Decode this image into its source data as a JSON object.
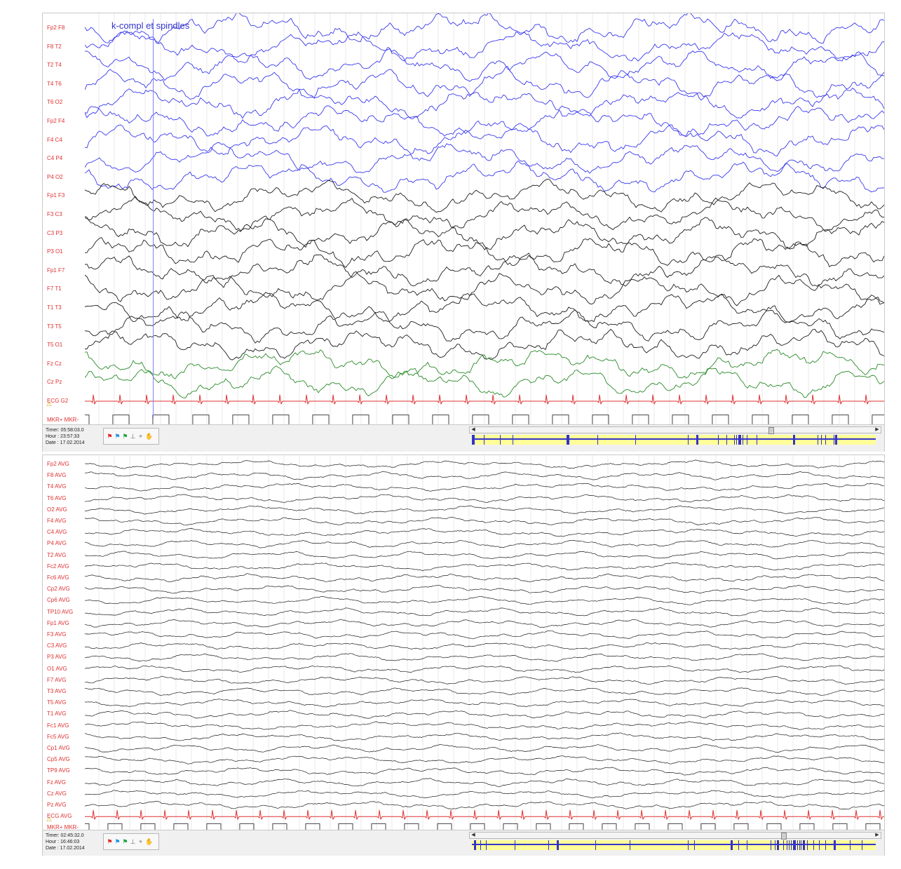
{
  "colors": {
    "blue": "#3a3aee",
    "black": "#1e1e1e",
    "green": "#2a8a2a",
    "red": "#e03030",
    "gray": "#444444",
    "label": "#e03030",
    "grid": "#dcdcdc"
  },
  "panel1": {
    "annotation": "k-compl et spindles",
    "channels": [
      {
        "label": "Fp2 F8",
        "color": "blue",
        "kind": "eeg"
      },
      {
        "label": "F8 T2",
        "color": "blue",
        "kind": "eeg"
      },
      {
        "label": "T2 T4",
        "color": "blue",
        "kind": "eeg"
      },
      {
        "label": "T4 T6",
        "color": "blue",
        "kind": "eeg"
      },
      {
        "label": "T6 O2",
        "color": "blue",
        "kind": "eeg"
      },
      {
        "label": "Fp2 F4",
        "color": "blue",
        "kind": "eeg"
      },
      {
        "label": "F4 C4",
        "color": "blue",
        "kind": "eeg"
      },
      {
        "label": "C4 P4",
        "color": "blue",
        "kind": "eeg"
      },
      {
        "label": "P4 O2",
        "color": "blue",
        "kind": "eeg"
      },
      {
        "label": "Fp1 F3",
        "color": "black",
        "kind": "eeg"
      },
      {
        "label": "F3 C3",
        "color": "black",
        "kind": "eeg"
      },
      {
        "label": "C3 P3",
        "color": "black",
        "kind": "eeg"
      },
      {
        "label": "P3 O1",
        "color": "black",
        "kind": "eeg"
      },
      {
        "label": "Fp1 F7",
        "color": "black",
        "kind": "eeg"
      },
      {
        "label": "F7 T1",
        "color": "black",
        "kind": "eeg"
      },
      {
        "label": "T1 T3",
        "color": "black",
        "kind": "eeg"
      },
      {
        "label": "T3 T5",
        "color": "black",
        "kind": "eeg"
      },
      {
        "label": "T5 O1",
        "color": "black",
        "kind": "eeg"
      },
      {
        "label": "Fz Cz",
        "color": "green",
        "kind": "eeg"
      },
      {
        "label": "Cz Pz",
        "color": "green",
        "kind": "eeg"
      },
      {
        "label": "ECG G2",
        "color": "red",
        "kind": "ecg",
        "warning": true
      },
      {
        "label": "MKR+ MKR-",
        "color": "gray",
        "kind": "marker"
      }
    ],
    "status": {
      "timer": "Timer: 05:58:03.0",
      "hour": "Hour : 23:57:33",
      "date": "Date : 17.02.2014"
    },
    "nav_markers": [
      0.0,
      0.005,
      0.03,
      0.07,
      0.1,
      0.235,
      0.24,
      0.31,
      0.405,
      0.535,
      0.555,
      0.61,
      0.63,
      0.65,
      0.655,
      0.66,
      0.665,
      0.67,
      0.68,
      0.705,
      0.795,
      0.855,
      0.865,
      0.875,
      0.895,
      0.9
    ],
    "scroll_pos": 0.74
  },
  "panel2": {
    "channels": [
      {
        "label": "Fp2 AVG",
        "color": "black",
        "kind": "eeg"
      },
      {
        "label": "F8 AVG",
        "color": "black",
        "kind": "eeg"
      },
      {
        "label": "T4 AVG",
        "color": "black",
        "kind": "eeg"
      },
      {
        "label": "T6 AVG",
        "color": "black",
        "kind": "eeg"
      },
      {
        "label": "O2 AVG",
        "color": "black",
        "kind": "eeg"
      },
      {
        "label": "F4 AVG",
        "color": "black",
        "kind": "eeg"
      },
      {
        "label": "C4 AVG",
        "color": "black",
        "kind": "eeg"
      },
      {
        "label": "P4 AVG",
        "color": "black",
        "kind": "eeg"
      },
      {
        "label": "T2 AVG",
        "color": "black",
        "kind": "eeg"
      },
      {
        "label": "Fc2 AVG",
        "color": "black",
        "kind": "eeg"
      },
      {
        "label": "Fc6 AVG",
        "color": "black",
        "kind": "eeg"
      },
      {
        "label": "Cp2 AVG",
        "color": "black",
        "kind": "eeg"
      },
      {
        "label": "Cp6 AVG",
        "color": "black",
        "kind": "eeg"
      },
      {
        "label": "TP10 AVG",
        "color": "black",
        "kind": "eeg"
      },
      {
        "label": "Fp1 AVG",
        "color": "black",
        "kind": "eeg"
      },
      {
        "label": "F3 AVG",
        "color": "black",
        "kind": "eeg"
      },
      {
        "label": "C3 AVG",
        "color": "black",
        "kind": "eeg"
      },
      {
        "label": "P3 AVG",
        "color": "black",
        "kind": "eeg"
      },
      {
        "label": "O1 AVG",
        "color": "black",
        "kind": "eeg"
      },
      {
        "label": "F7 AVG",
        "color": "black",
        "kind": "eeg"
      },
      {
        "label": "T3 AVG",
        "color": "black",
        "kind": "eeg"
      },
      {
        "label": "T5 AVG",
        "color": "black",
        "kind": "eeg"
      },
      {
        "label": "T1 AVG",
        "color": "black",
        "kind": "eeg"
      },
      {
        "label": "Fc1 AVG",
        "color": "black",
        "kind": "eeg"
      },
      {
        "label": "Fc5 AVG",
        "color": "black",
        "kind": "eeg"
      },
      {
        "label": "Cp1 AVG",
        "color": "black",
        "kind": "eeg"
      },
      {
        "label": "Cp5 AVG",
        "color": "black",
        "kind": "eeg"
      },
      {
        "label": "TP9 AVG",
        "color": "black",
        "kind": "eeg"
      },
      {
        "label": "Fz AVG",
        "color": "black",
        "kind": "eeg"
      },
      {
        "label": "Cz AVG",
        "color": "black",
        "kind": "eeg"
      },
      {
        "label": "Pz AVG",
        "color": "black",
        "kind": "eeg"
      },
      {
        "label": "ECG AVG",
        "color": "red",
        "kind": "ecg",
        "warning": true
      },
      {
        "label": "MKR+ MKR-",
        "color": "gray",
        "kind": "marker"
      }
    ],
    "status": {
      "timer": "Timer: 02:45:32.0",
      "hour": "Hour : 16:46:03",
      "date": "Date : 17.02.2014"
    },
    "nav_markers": [
      0.005,
      0.02,
      0.035,
      0.105,
      0.19,
      0.21,
      0.305,
      0.39,
      0.535,
      0.55,
      0.64,
      0.66,
      0.68,
      0.74,
      0.75,
      0.755,
      0.77,
      0.78,
      0.785,
      0.79,
      0.795,
      0.8,
      0.805,
      0.81,
      0.815,
      0.82,
      0.83,
      0.845,
      0.86,
      0.875,
      0.895,
      0.935,
      0.965
    ],
    "scroll_pos": 0.77
  },
  "toolbar_icons": [
    "red-flag-icon",
    "blue-flag-icon",
    "green-flag-icon",
    "baseline-icon",
    "tools-icon",
    "hand-icon"
  ]
}
